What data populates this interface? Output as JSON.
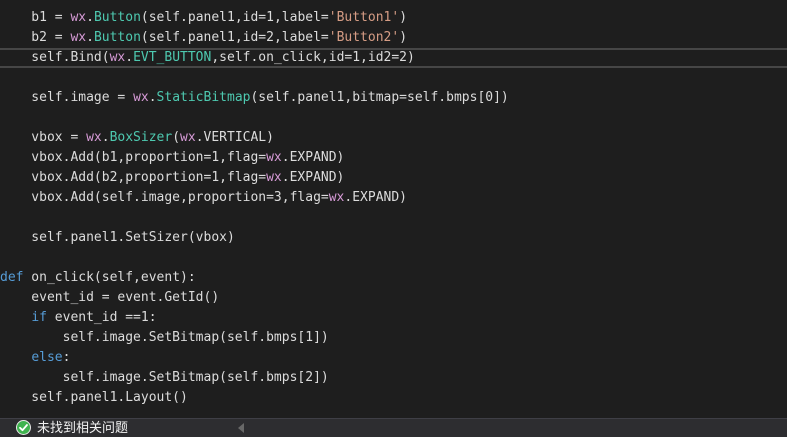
{
  "code": {
    "lines": [
      [
        {
          "t": "    b1 = ",
          "c": "txt"
        },
        {
          "t": "wx",
          "c": "mod"
        },
        {
          "t": ".",
          "c": "txt"
        },
        {
          "t": "Button",
          "c": "cls"
        },
        {
          "t": "(self.panel1,id=1,label=",
          "c": "txt"
        },
        {
          "t": "'Button1'",
          "c": "str"
        },
        {
          "t": ")",
          "c": "txt"
        }
      ],
      [
        {
          "t": "    b2 = ",
          "c": "txt"
        },
        {
          "t": "wx",
          "c": "mod"
        },
        {
          "t": ".",
          "c": "txt"
        },
        {
          "t": "Button",
          "c": "cls"
        },
        {
          "t": "(self.panel1,id=2,label=",
          "c": "txt"
        },
        {
          "t": "'Button2'",
          "c": "str"
        },
        {
          "t": ")",
          "c": "txt"
        }
      ],
      [
        {
          "t": "    self.Bind(",
          "c": "txt"
        },
        {
          "t": "wx",
          "c": "mod"
        },
        {
          "t": ".",
          "c": "txt"
        },
        {
          "t": "EVT_BUTTON",
          "c": "cls"
        },
        {
          "t": ",self.on_click,id=1,id2=2)",
          "c": "txt"
        }
      ],
      [],
      [
        {
          "t": "    self.image = ",
          "c": "txt"
        },
        {
          "t": "wx",
          "c": "mod"
        },
        {
          "t": ".",
          "c": "txt"
        },
        {
          "t": "StaticBitmap",
          "c": "cls"
        },
        {
          "t": "(self.panel1,bitmap=self.bmps[0])",
          "c": "txt"
        }
      ],
      [],
      [
        {
          "t": "    vbox = ",
          "c": "txt"
        },
        {
          "t": "wx",
          "c": "mod"
        },
        {
          "t": ".",
          "c": "txt"
        },
        {
          "t": "BoxSizer",
          "c": "cls"
        },
        {
          "t": "(",
          "c": "txt"
        },
        {
          "t": "wx",
          "c": "mod"
        },
        {
          "t": ".VERTICAL)",
          "c": "txt"
        }
      ],
      [
        {
          "t": "    vbox.Add(b1,proportion=1,flag=",
          "c": "txt"
        },
        {
          "t": "wx",
          "c": "mod"
        },
        {
          "t": ".EXPAND)",
          "c": "txt"
        }
      ],
      [
        {
          "t": "    vbox.Add(b2,proportion=1,flag=",
          "c": "txt"
        },
        {
          "t": "wx",
          "c": "mod"
        },
        {
          "t": ".EXPAND)",
          "c": "txt"
        }
      ],
      [
        {
          "t": "    vbox.Add(self.image,proportion=3,flag=",
          "c": "txt"
        },
        {
          "t": "wx",
          "c": "mod"
        },
        {
          "t": ".EXPAND)",
          "c": "txt"
        }
      ],
      [],
      [
        {
          "t": "    self.panel1.SetSizer(vbox)",
          "c": "txt"
        }
      ],
      [],
      [
        {
          "t": "def",
          "c": "kw"
        },
        {
          "t": " on_click(self,event):",
          "c": "txt"
        }
      ],
      [
        {
          "t": "    event_id = event.GetId()",
          "c": "txt"
        }
      ],
      [
        {
          "t": "    ",
          "c": "txt"
        },
        {
          "t": "if",
          "c": "kw"
        },
        {
          "t": " event_id ==1:",
          "c": "txt"
        }
      ],
      [
        {
          "t": "        self.image.SetBitmap(self.bmps[1])",
          "c": "txt"
        }
      ],
      [
        {
          "t": "    ",
          "c": "txt"
        },
        {
          "t": "else",
          "c": "kw"
        },
        {
          "t": ":",
          "c": "txt"
        }
      ],
      [
        {
          "t": "        self.image.SetBitmap(self.bmps[2])",
          "c": "txt"
        }
      ],
      [
        {
          "t": "    self.panel1.Layout()",
          "c": "txt"
        }
      ]
    ],
    "current_line_index": 2
  },
  "colors": {
    "background": "#1e1e1e",
    "keyword": "#569cd6",
    "module": "#d69ad6",
    "class": "#4ec9b0",
    "string": "#d69d85",
    "text": "#dcdcdc",
    "status_ok": "#3fb34f"
  },
  "status_bar": {
    "icon": "check-circle-icon",
    "message": "未找到相关问题"
  }
}
